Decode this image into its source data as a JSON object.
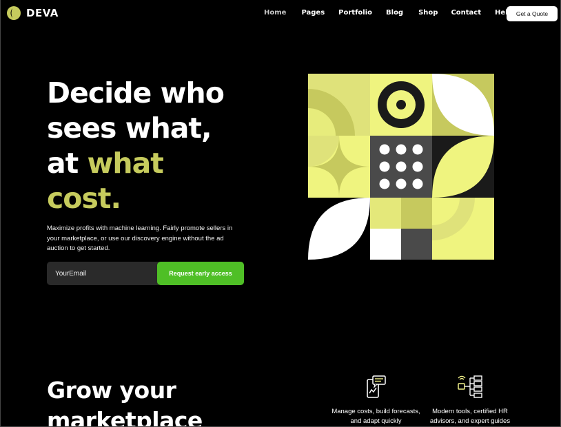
{
  "brand": {
    "name": "DEVA",
    "accent": "#c6cb5d"
  },
  "nav": {
    "items": [
      {
        "label": "Home",
        "active": true
      },
      {
        "label": "Pages"
      },
      {
        "label": "Portfolio"
      },
      {
        "label": "Blog"
      },
      {
        "label": "Shop"
      },
      {
        "label": "Contact"
      },
      {
        "label": "Help"
      }
    ],
    "cta_label": "Get a Quote"
  },
  "hero": {
    "title_line1": "Decide who",
    "title_line2": "sees what,",
    "title_line3_plain": "at ",
    "title_line3_highlight": "what",
    "title_line4_highlight": "cost.",
    "description": "Maximize profits with machine learning. Fairly promote sellers in your marketplace, or use our discovery engine without the ad auction to get started.",
    "email_placeholder": "YourEmail",
    "cta_label": "Request early access",
    "cta_color": "#4fbf26"
  },
  "section2": {
    "title": "Grow your marketplace",
    "features": [
      {
        "icon": "mobile-chat-chart-icon",
        "text": "Manage costs, build forecasts, and adapt quickly"
      },
      {
        "icon": "network-devices-icon",
        "text": "Modern tools, certified HR advisors, and expert guides"
      }
    ]
  }
}
